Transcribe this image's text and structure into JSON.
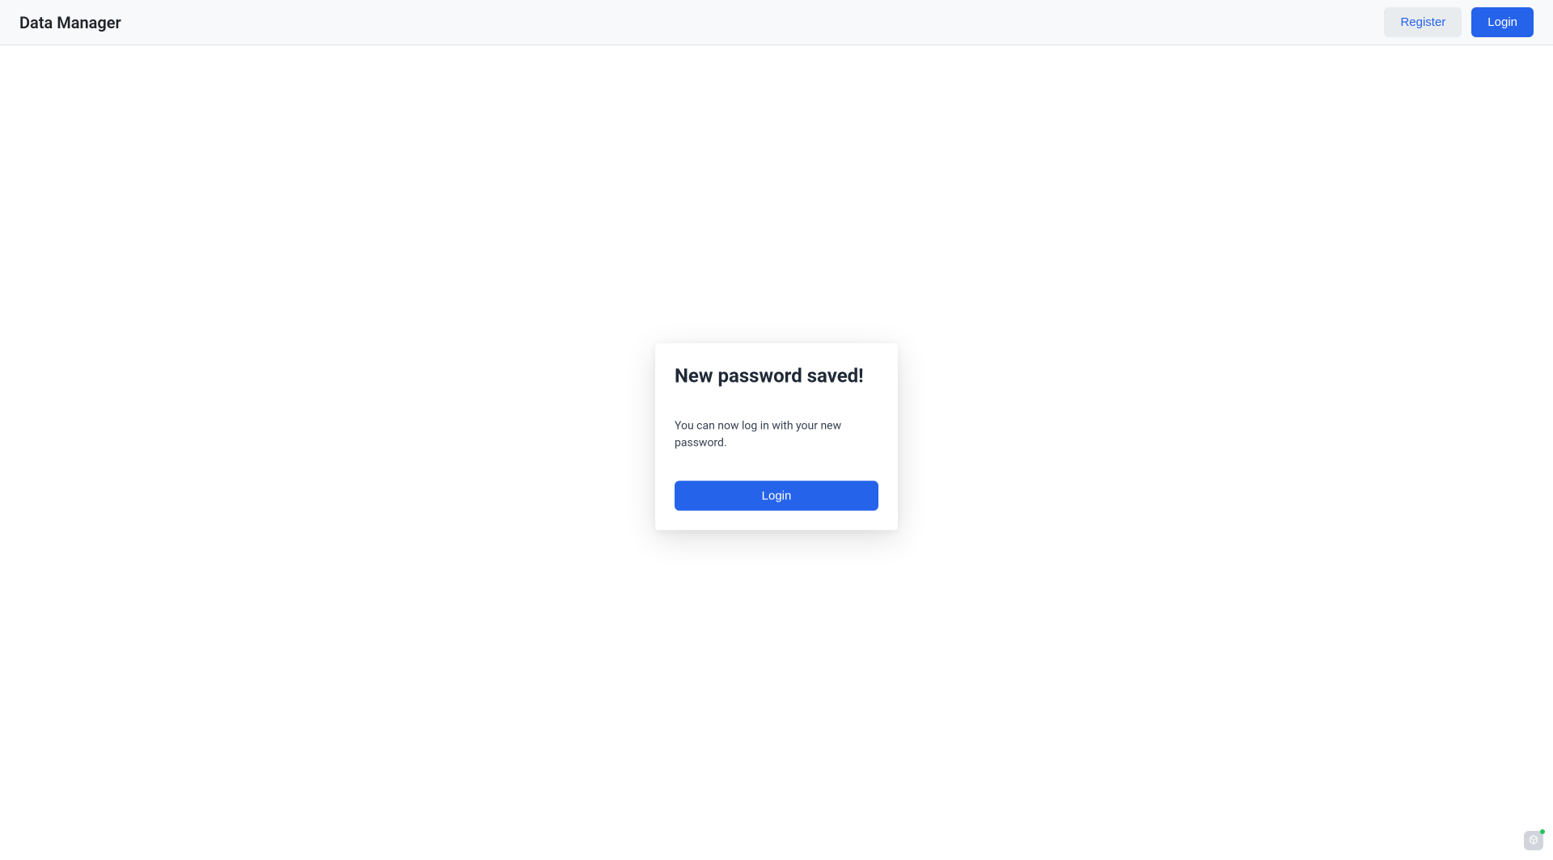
{
  "navbar": {
    "brand": "Data Manager",
    "register_label": "Register",
    "login_label": "Login"
  },
  "card": {
    "title": "New password saved!",
    "text": "You can now log in with your new password.",
    "login_button": "Login"
  }
}
